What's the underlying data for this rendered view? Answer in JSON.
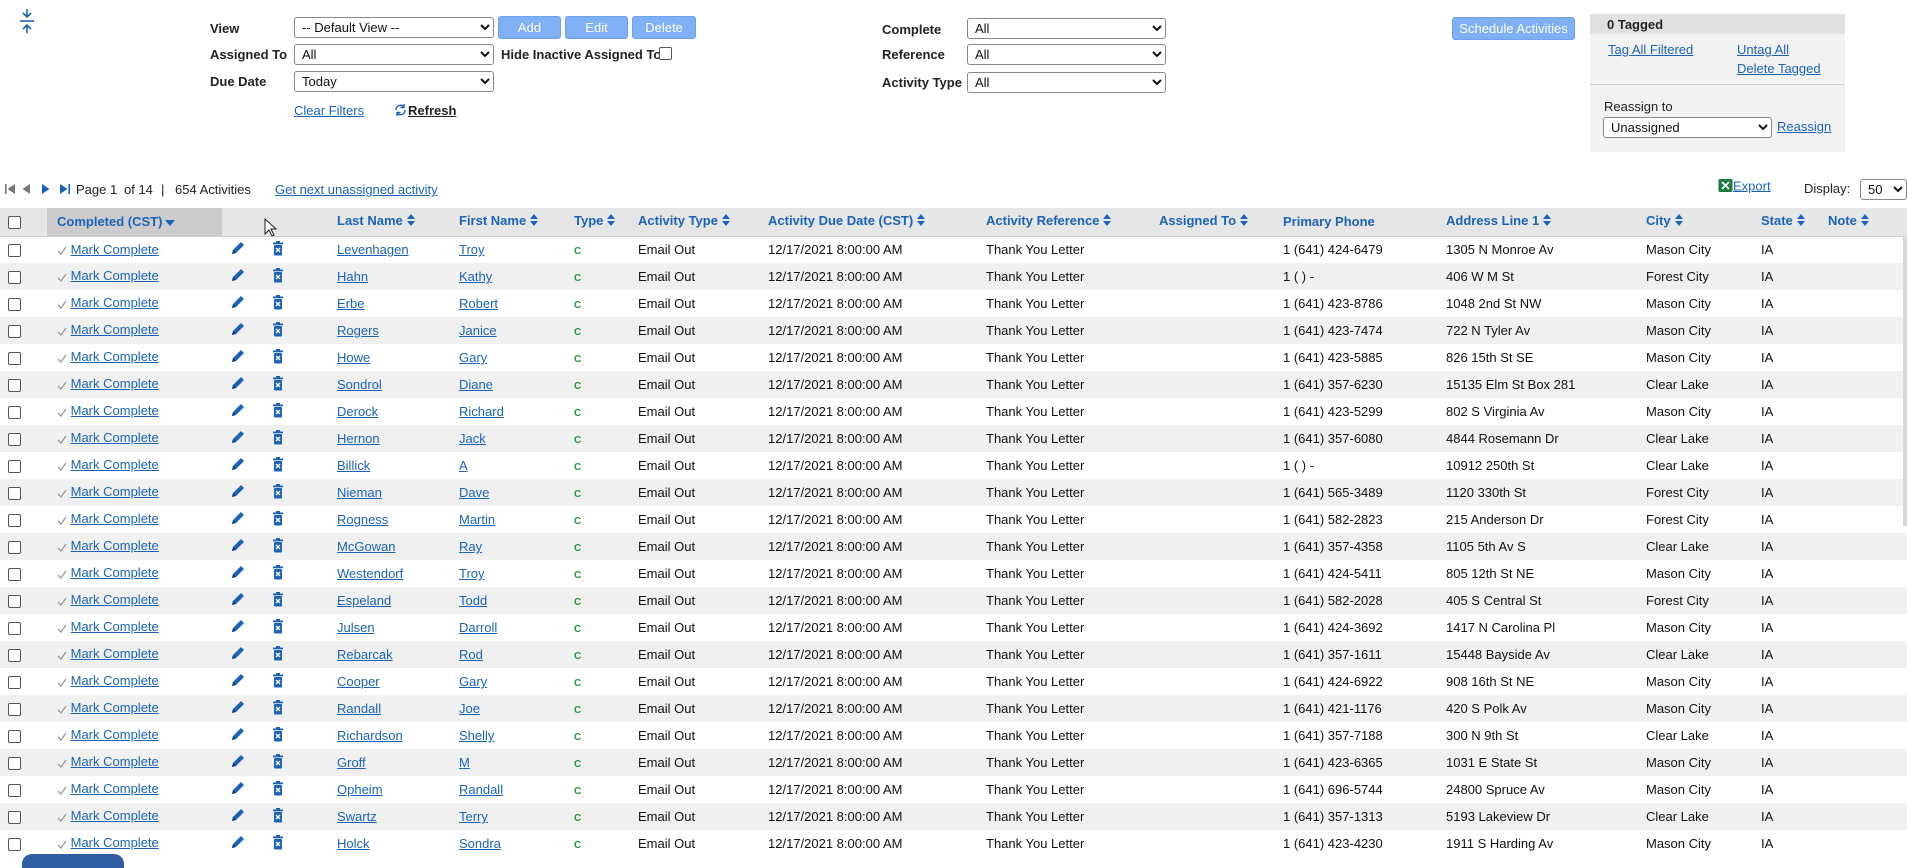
{
  "toolbar": {
    "view_label": "View",
    "view_value": "-- Default View --",
    "add_label": "Add",
    "edit_label": "Edit",
    "delete_label": "Delete",
    "assigned_to_label": "Assigned To",
    "assigned_to_value": "All",
    "hide_inactive_label": "Hide Inactive Assigned To",
    "due_date_label": "Due Date",
    "due_date_value": "Today",
    "clear_filters_label": "Clear Filters",
    "refresh_label": "Refresh",
    "complete_label": "Complete",
    "complete_value": "All",
    "reference_label": "Reference",
    "reference_value": "All",
    "activity_type_label": "Activity Type",
    "activity_type_value": "All",
    "schedule_label": "Schedule Activities"
  },
  "tag_panel": {
    "header": "0 Tagged",
    "tag_all_label": "Tag All Filtered",
    "untag_all_label": "Untag All",
    "delete_tagged_label": "Delete Tagged",
    "reassign_to_label": "Reassign to",
    "reassign_value": "Unassigned",
    "reassign_link": "Reassign"
  },
  "pager": {
    "page_text": "Page 1",
    "of_text": "of 14",
    "separator": "|",
    "count_text": "654 Activities",
    "next_unassigned_label": "Get next unassigned activity",
    "export_label": "Export",
    "display_label": "Display:",
    "display_value": "50"
  },
  "columns": {
    "completed": "Completed (CST)",
    "last_name": "Last Name",
    "first_name": "First Name",
    "type": "Type",
    "activity_type": "Activity Type",
    "due_date": "Activity Due Date (CST)",
    "reference": "Activity Reference",
    "assigned_to": "Assigned To",
    "phone": "Primary Phone",
    "address": "Address Line 1",
    "city": "City",
    "state": "State",
    "note": "Note"
  },
  "colors": {
    "link": "#1a63b8",
    "button": "#7fb0f3",
    "type_code": "#1e9a3a"
  },
  "rows": [
    {
      "complete": "Mark Complete",
      "last": "Levenhagen",
      "first": "Troy",
      "type": "C",
      "activity_type": "Email Out",
      "due": "12/17/2021 8:00:00 AM",
      "reference": "Thank You Letter",
      "assigned": "",
      "phone": "1 (641) 424-6479",
      "address": "1305 N Monroe Av",
      "city": "Mason City",
      "state": "IA",
      "note": ""
    },
    {
      "complete": "Mark Complete",
      "last": "Hahn",
      "first": "Kathy",
      "type": "C",
      "activity_type": "Email Out",
      "due": "12/17/2021 8:00:00 AM",
      "reference": "Thank You Letter",
      "assigned": "",
      "phone": "1 ( ) -",
      "address": "406 W M St",
      "city": "Forest City",
      "state": "IA",
      "note": ""
    },
    {
      "complete": "Mark Complete",
      "last": "Erbe",
      "first": "Robert",
      "type": "C",
      "activity_type": "Email Out",
      "due": "12/17/2021 8:00:00 AM",
      "reference": "Thank You Letter",
      "assigned": "",
      "phone": "1 (641) 423-8786",
      "address": "1048 2nd St NW",
      "city": "Mason City",
      "state": "IA",
      "note": ""
    },
    {
      "complete": "Mark Complete",
      "last": "Rogers",
      "first": "Janice",
      "type": "C",
      "activity_type": "Email Out",
      "due": "12/17/2021 8:00:00 AM",
      "reference": "Thank You Letter",
      "assigned": "",
      "phone": "1 (641) 423-7474",
      "address": "722 N Tyler Av",
      "city": "Mason City",
      "state": "IA",
      "note": ""
    },
    {
      "complete": "Mark Complete",
      "last": "Howe",
      "first": "Gary",
      "type": "C",
      "activity_type": "Email Out",
      "due": "12/17/2021 8:00:00 AM",
      "reference": "Thank You Letter",
      "assigned": "",
      "phone": "1 (641) 423-5885",
      "address": "826 15th St SE",
      "city": "Mason City",
      "state": "IA",
      "note": ""
    },
    {
      "complete": "Mark Complete",
      "last": "Sondrol",
      "first": "Diane",
      "type": "C",
      "activity_type": "Email Out",
      "due": "12/17/2021 8:00:00 AM",
      "reference": "Thank You Letter",
      "assigned": "",
      "phone": "1 (641) 357-6230",
      "address": "15135 Elm St Box 281",
      "city": "Clear Lake",
      "state": "IA",
      "note": ""
    },
    {
      "complete": "Mark Complete",
      "last": "Derock",
      "first": "Richard",
      "type": "C",
      "activity_type": "Email Out",
      "due": "12/17/2021 8:00:00 AM",
      "reference": "Thank You Letter",
      "assigned": "",
      "phone": "1 (641) 423-5299",
      "address": "802 S Virginia Av",
      "city": "Mason City",
      "state": "IA",
      "note": ""
    },
    {
      "complete": "Mark Complete",
      "last": "Hernon",
      "first": "Jack",
      "type": "C",
      "activity_type": "Email Out",
      "due": "12/17/2021 8:00:00 AM",
      "reference": "Thank You Letter",
      "assigned": "",
      "phone": "1 (641) 357-6080",
      "address": "4844 Rosemann Dr",
      "city": "Clear Lake",
      "state": "IA",
      "note": ""
    },
    {
      "complete": "Mark Complete",
      "last": "Billick",
      "first": "A",
      "type": "C",
      "activity_type": "Email Out",
      "due": "12/17/2021 8:00:00 AM",
      "reference": "Thank You Letter",
      "assigned": "",
      "phone": "1 ( ) -",
      "address": "10912 250th St",
      "city": "Clear Lake",
      "state": "IA",
      "note": ""
    },
    {
      "complete": "Mark Complete",
      "last": "Nieman",
      "first": "Dave",
      "type": "C",
      "activity_type": "Email Out",
      "due": "12/17/2021 8:00:00 AM",
      "reference": "Thank You Letter",
      "assigned": "",
      "phone": "1 (641) 565-3489",
      "address": "1120 330th St",
      "city": "Forest City",
      "state": "IA",
      "note": ""
    },
    {
      "complete": "Mark Complete",
      "last": "Rogness",
      "first": "Martin",
      "type": "C",
      "activity_type": "Email Out",
      "due": "12/17/2021 8:00:00 AM",
      "reference": "Thank You Letter",
      "assigned": "",
      "phone": "1 (641) 582-2823",
      "address": "215 Anderson Dr",
      "city": "Forest City",
      "state": "IA",
      "note": ""
    },
    {
      "complete": "Mark Complete",
      "last": "McGowan",
      "first": "Ray",
      "type": "C",
      "activity_type": "Email Out",
      "due": "12/17/2021 8:00:00 AM",
      "reference": "Thank You Letter",
      "assigned": "",
      "phone": "1 (641) 357-4358",
      "address": "1105 5th Av S",
      "city": "Clear Lake",
      "state": "IA",
      "note": ""
    },
    {
      "complete": "Mark Complete",
      "last": "Westendorf",
      "first": "Troy",
      "type": "C",
      "activity_type": "Email Out",
      "due": "12/17/2021 8:00:00 AM",
      "reference": "Thank You Letter",
      "assigned": "",
      "phone": "1 (641) 424-5411",
      "address": "805 12th St NE",
      "city": "Mason City",
      "state": "IA",
      "note": ""
    },
    {
      "complete": "Mark Complete",
      "last": "Espeland",
      "first": "Todd",
      "type": "C",
      "activity_type": "Email Out",
      "due": "12/17/2021 8:00:00 AM",
      "reference": "Thank You Letter",
      "assigned": "",
      "phone": "1 (641) 582-2028",
      "address": "405 S Central St",
      "city": "Forest City",
      "state": "IA",
      "note": ""
    },
    {
      "complete": "Mark Complete",
      "last": "Julsen",
      "first": "Darroll",
      "type": "C",
      "activity_type": "Email Out",
      "due": "12/17/2021 8:00:00 AM",
      "reference": "Thank You Letter",
      "assigned": "",
      "phone": "1 (641) 424-3692",
      "address": "1417 N Carolina Pl",
      "city": "Mason City",
      "state": "IA",
      "note": ""
    },
    {
      "complete": "Mark Complete",
      "last": "Rebarcak",
      "first": "Rod",
      "type": "C",
      "activity_type": "Email Out",
      "due": "12/17/2021 8:00:00 AM",
      "reference": "Thank You Letter",
      "assigned": "",
      "phone": "1 (641) 357-1611",
      "address": "15448 Bayside Av",
      "city": "Clear Lake",
      "state": "IA",
      "note": ""
    },
    {
      "complete": "Mark Complete",
      "last": "Cooper",
      "first": "Gary",
      "type": "C",
      "activity_type": "Email Out",
      "due": "12/17/2021 8:00:00 AM",
      "reference": "Thank You Letter",
      "assigned": "",
      "phone": "1 (641) 424-6922",
      "address": "908 16th St NE",
      "city": "Mason City",
      "state": "IA",
      "note": ""
    },
    {
      "complete": "Mark Complete",
      "last": "Randall",
      "first": "Joe",
      "type": "C",
      "activity_type": "Email Out",
      "due": "12/17/2021 8:00:00 AM",
      "reference": "Thank You Letter",
      "assigned": "",
      "phone": "1 (641) 421-1176",
      "address": "420 S Polk Av",
      "city": "Mason City",
      "state": "IA",
      "note": ""
    },
    {
      "complete": "Mark Complete",
      "last": "Richardson",
      "first": "Shelly",
      "type": "C",
      "activity_type": "Email Out",
      "due": "12/17/2021 8:00:00 AM",
      "reference": "Thank You Letter",
      "assigned": "",
      "phone": "1 (641) 357-7188",
      "address": "300 N 9th St",
      "city": "Clear Lake",
      "state": "IA",
      "note": ""
    },
    {
      "complete": "Mark Complete",
      "last": "Groff",
      "first": "M",
      "type": "C",
      "activity_type": "Email Out",
      "due": "12/17/2021 8:00:00 AM",
      "reference": "Thank You Letter",
      "assigned": "",
      "phone": "1 (641) 423-6365",
      "address": "1031 E State St",
      "city": "Mason City",
      "state": "IA",
      "note": ""
    },
    {
      "complete": "Mark Complete",
      "last": "Opheim",
      "first": "Randall",
      "type": "C",
      "activity_type": "Email Out",
      "due": "12/17/2021 8:00:00 AM",
      "reference": "Thank You Letter",
      "assigned": "",
      "phone": "1 (641) 696-5744",
      "address": "24800 Spruce Av",
      "city": "Mason City",
      "state": "IA",
      "note": ""
    },
    {
      "complete": "Mark Complete",
      "last": "Swartz",
      "first": "Terry",
      "type": "C",
      "activity_type": "Email Out",
      "due": "12/17/2021 8:00:00 AM",
      "reference": "Thank You Letter",
      "assigned": "",
      "phone": "1 (641) 357-1313",
      "address": "5193 Lakeview Dr",
      "city": "Clear Lake",
      "state": "IA",
      "note": ""
    },
    {
      "complete": "Mark Complete",
      "last": "Holck",
      "first": "Sondra",
      "type": "C",
      "activity_type": "Email Out",
      "due": "12/17/2021 8:00:00 AM",
      "reference": "Thank You Letter",
      "assigned": "",
      "phone": "1 (641) 423-4230",
      "address": "1911 S Harding Av",
      "city": "Mason City",
      "state": "IA",
      "note": ""
    }
  ]
}
